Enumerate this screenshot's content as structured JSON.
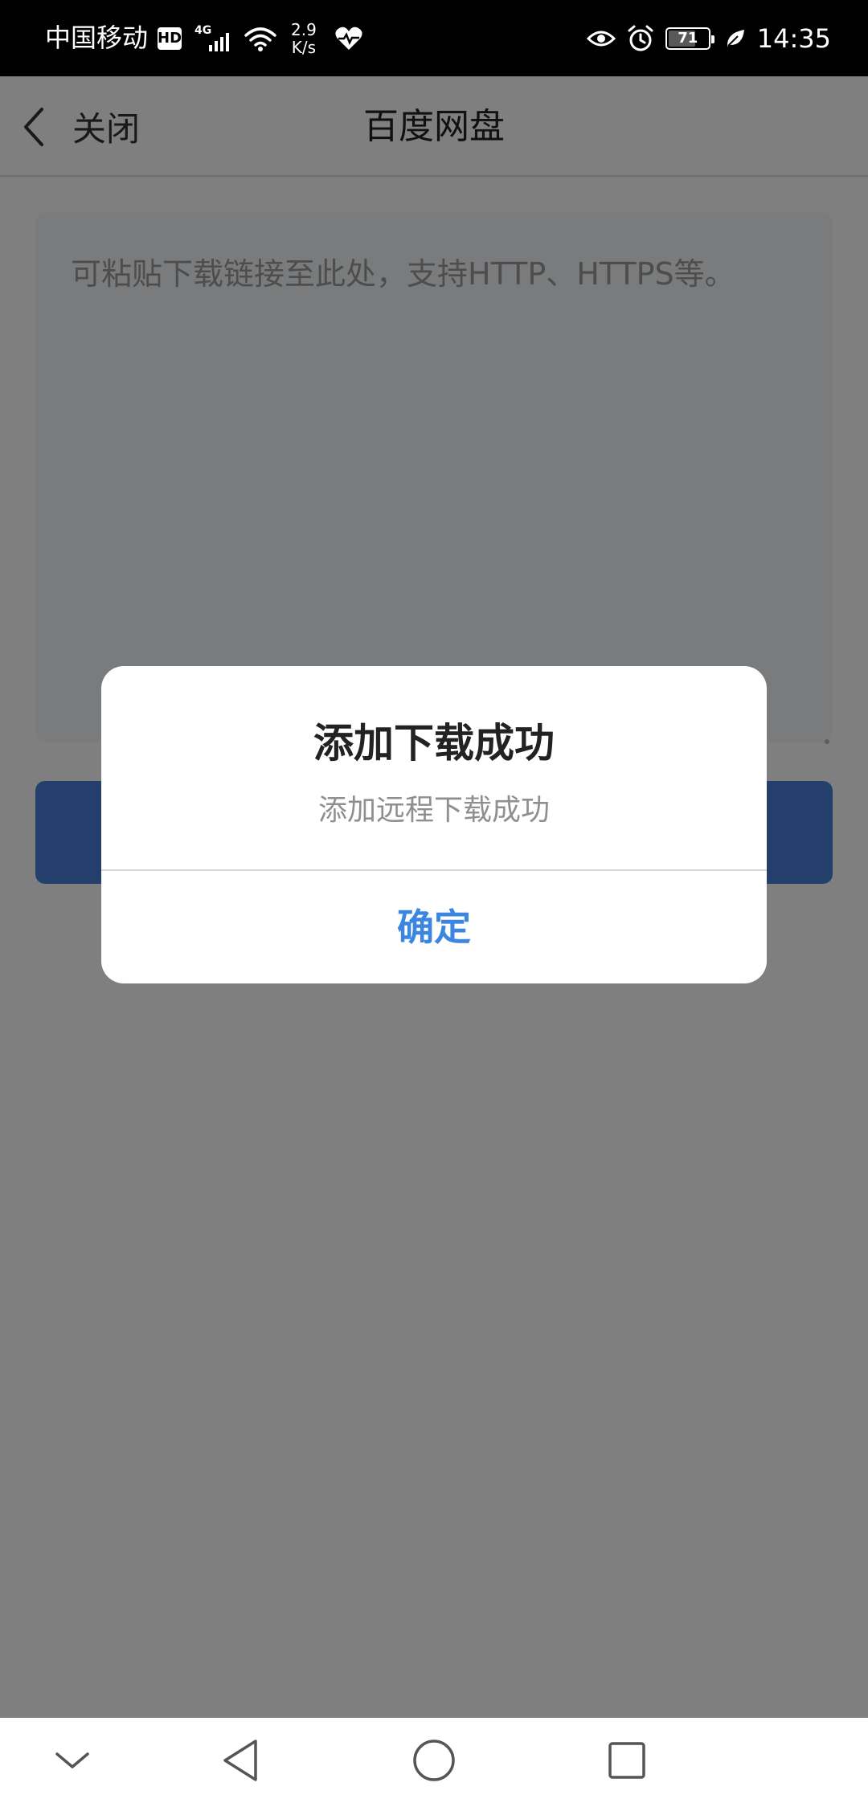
{
  "status_bar": {
    "carrier": "中国移动",
    "hd_badge": "HD",
    "network_type": "4G",
    "net_speed_value": "2.9",
    "net_speed_unit": "K/s",
    "battery_level": "71",
    "battery_fraction": 0.71,
    "time": "14:35"
  },
  "header": {
    "back_label": "关闭",
    "title": "百度网盘"
  },
  "content": {
    "textarea_placeholder": "可粘贴下载链接至此处，支持HTTP、HTTPS等。"
  },
  "dialog": {
    "title": "添加下载成功",
    "message": "添加远程下载成功",
    "ok_label": "确定"
  },
  "nav_bar": {
    "icons": [
      "chevron-down-icon",
      "back-triangle-icon",
      "home-circle-icon",
      "recent-square-icon"
    ]
  },
  "colors": {
    "status_bar_bg": "#000000",
    "primary_button": "#4a7fd8",
    "dialog_action": "#3b86e0",
    "overlay": "rgba(0,0,0,0.5)"
  }
}
